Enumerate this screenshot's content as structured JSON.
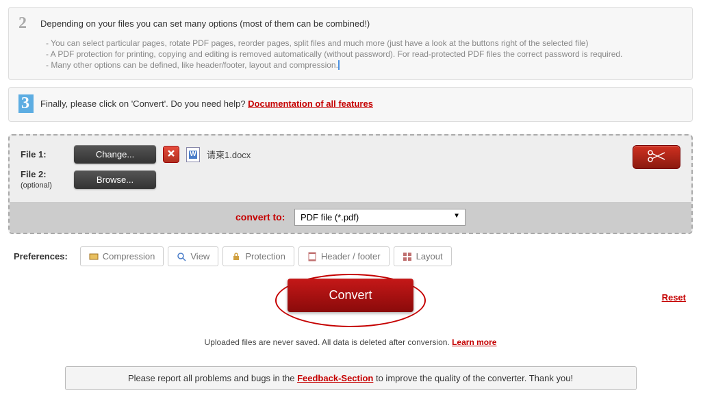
{
  "step2": {
    "title": "Depending on your files you can set many options (most of them can be combined!)",
    "line1": "- You can select particular pages, rotate PDF pages, reorder pages, split files and much more (just have a look at the buttons right of the selected file)",
    "line2": "- A PDF protection for printing, copying and editing is removed automatically (without password). For read-protected PDF files the correct password is required.",
    "line3": "- Many other options can be defined, like header/footer, layout and compression."
  },
  "step3": {
    "title_prefix": "Finally, please click on 'Convert'. Do you need help? ",
    "doc_link": "Documentation of all features"
  },
  "files": {
    "file1_label": "File 1:",
    "file2_label": "File 2:",
    "file2_sub": "(optional)",
    "change_btn": "Change...",
    "browse_btn": "Browse...",
    "file1_name": "请柬1.docx"
  },
  "convert": {
    "label": "convert to:",
    "selected": "PDF file (*.pdf)"
  },
  "prefs": {
    "label": "Preferences:",
    "compression": "Compression",
    "view": "View",
    "protection": "Protection",
    "header_footer": "Header / footer",
    "layout": "Layout"
  },
  "action": {
    "convert_btn": "Convert",
    "reset": "Reset"
  },
  "note": {
    "text": "Uploaded files are never saved. All data is deleted after conversion. ",
    "link": "Learn more"
  },
  "feedback": {
    "prefix": "Please report all problems and bugs in the ",
    "link": "Feedback-Section",
    "suffix": " to improve the quality of the converter. Thank you!"
  }
}
